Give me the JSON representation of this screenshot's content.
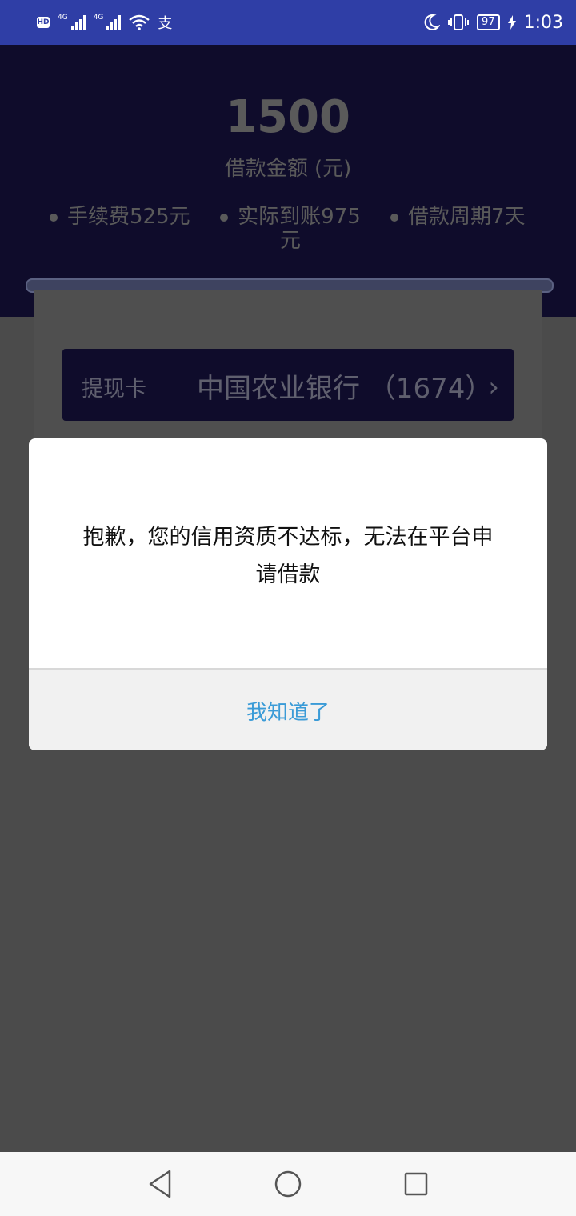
{
  "status_bar": {
    "network_1": "4G",
    "network_2": "4G",
    "battery": "97",
    "time": "1:03",
    "icons": [
      "hd-icon",
      "signal-icon",
      "wifi-icon",
      "alipay-icon",
      "moon-icon",
      "vibrate-icon",
      "battery-icon",
      "charging-icon"
    ],
    "background": "#2f3ea6"
  },
  "loan": {
    "amount": "1500",
    "amount_label": "借款金额 (元)",
    "fee": "手续费525元",
    "received": "实际到账975元",
    "period": "借款周期7天"
  },
  "bank": {
    "label": "提现卡",
    "name": "中国农业银行 （1674）",
    "chevron": "›"
  },
  "dialog": {
    "message": "抱歉，您的信用资质不达标，无法在平台申请借款",
    "button": "我知道了",
    "button_color": "#3a9bd7"
  },
  "nav_bar": {
    "icons": [
      "back-icon",
      "home-icon",
      "recent-apps-icon"
    ]
  }
}
